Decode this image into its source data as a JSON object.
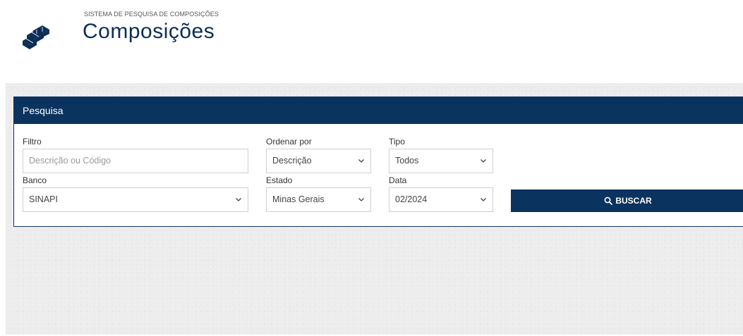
{
  "header": {
    "subtitle": "SISTEMA DE PESQUISA DE COMPOSIÇÕES",
    "title": "Composições"
  },
  "panel": {
    "title": "Pesquisa",
    "filtro": {
      "label": "Filtro",
      "placeholder": "Descrição ou Código"
    },
    "ordenar": {
      "label": "Ordenar por",
      "value": "Descrição"
    },
    "tipo": {
      "label": "Tipo",
      "value": "Todos"
    },
    "banco": {
      "label": "Banco",
      "value": "SINAPI"
    },
    "estado": {
      "label": "Estado",
      "value": "Minas Gerais"
    },
    "data": {
      "label": "Data",
      "value": "02/2024"
    },
    "buscar_label": "BUSCAR"
  },
  "colors": {
    "primary": "#0b335f",
    "background_band": "#ececec"
  },
  "icons": [
    "bricks-icon",
    "search-icon",
    "chevron-down-icon"
  ]
}
